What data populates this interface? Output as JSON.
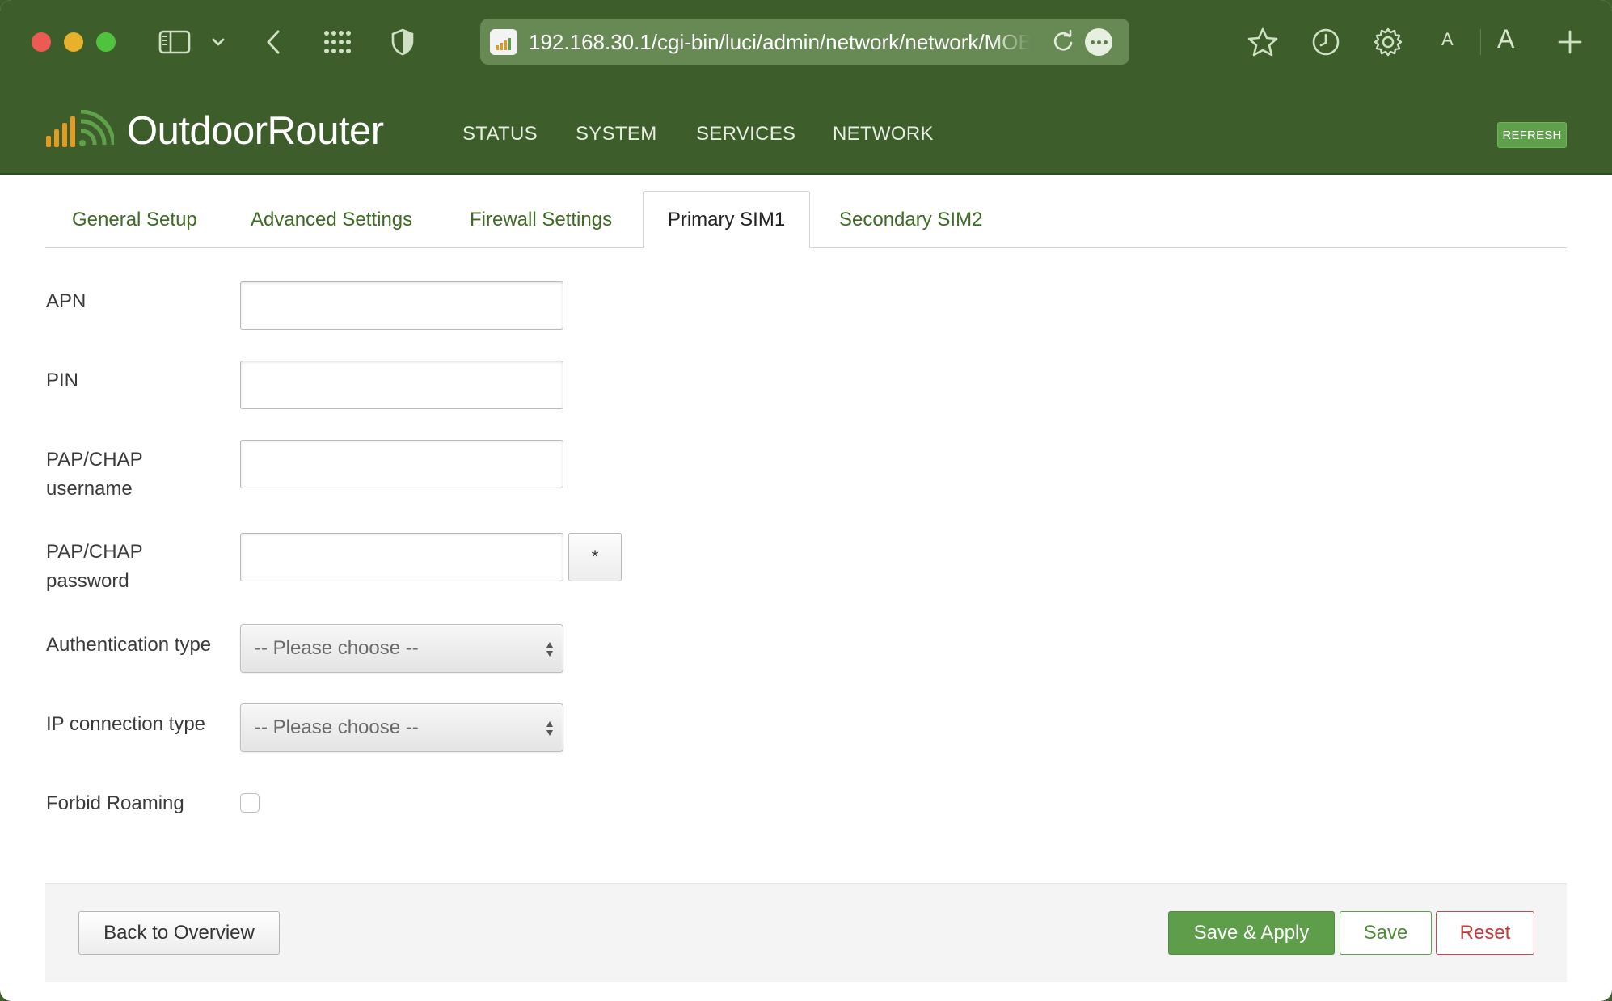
{
  "browser": {
    "url": "192.168.30.1/cgi-bin/luci/admin/network/network/MOBILE",
    "font_small": "A",
    "font_large": "A"
  },
  "app": {
    "brand": "OutdoorRouter",
    "nav": [
      "STATUS",
      "SYSTEM",
      "SERVICES",
      "NETWORK"
    ],
    "refresh_label": "REFRESH",
    "accent": "#3d5e2b",
    "logo_color": "#e69a1f"
  },
  "tabs": [
    {
      "label": "General Setup",
      "active": false
    },
    {
      "label": "Advanced Settings",
      "active": false
    },
    {
      "label": "Firewall Settings",
      "active": false
    },
    {
      "label": "Primary SIM1",
      "active": true
    },
    {
      "label": "Secondary SIM2",
      "active": false
    }
  ],
  "form": {
    "apn": {
      "label": "APN",
      "value": ""
    },
    "pin": {
      "label": "PIN",
      "value": ""
    },
    "username": {
      "label_line1": "PAP/CHAP",
      "label_line2": "username",
      "value": ""
    },
    "password": {
      "label_line1": "PAP/CHAP",
      "label_line2": "password",
      "value": "",
      "reveal_label": "*"
    },
    "auth_type": {
      "label": "Authentication type",
      "selected": "-- Please choose --"
    },
    "ip_type": {
      "label": "IP connection type",
      "selected": "-- Please choose --"
    },
    "forbid_roaming": {
      "label": "Forbid Roaming",
      "checked": false
    }
  },
  "footer": {
    "back_label": "Back to Overview",
    "apply_label": "Save & Apply",
    "save_label": "Save",
    "reset_label": "Reset"
  }
}
